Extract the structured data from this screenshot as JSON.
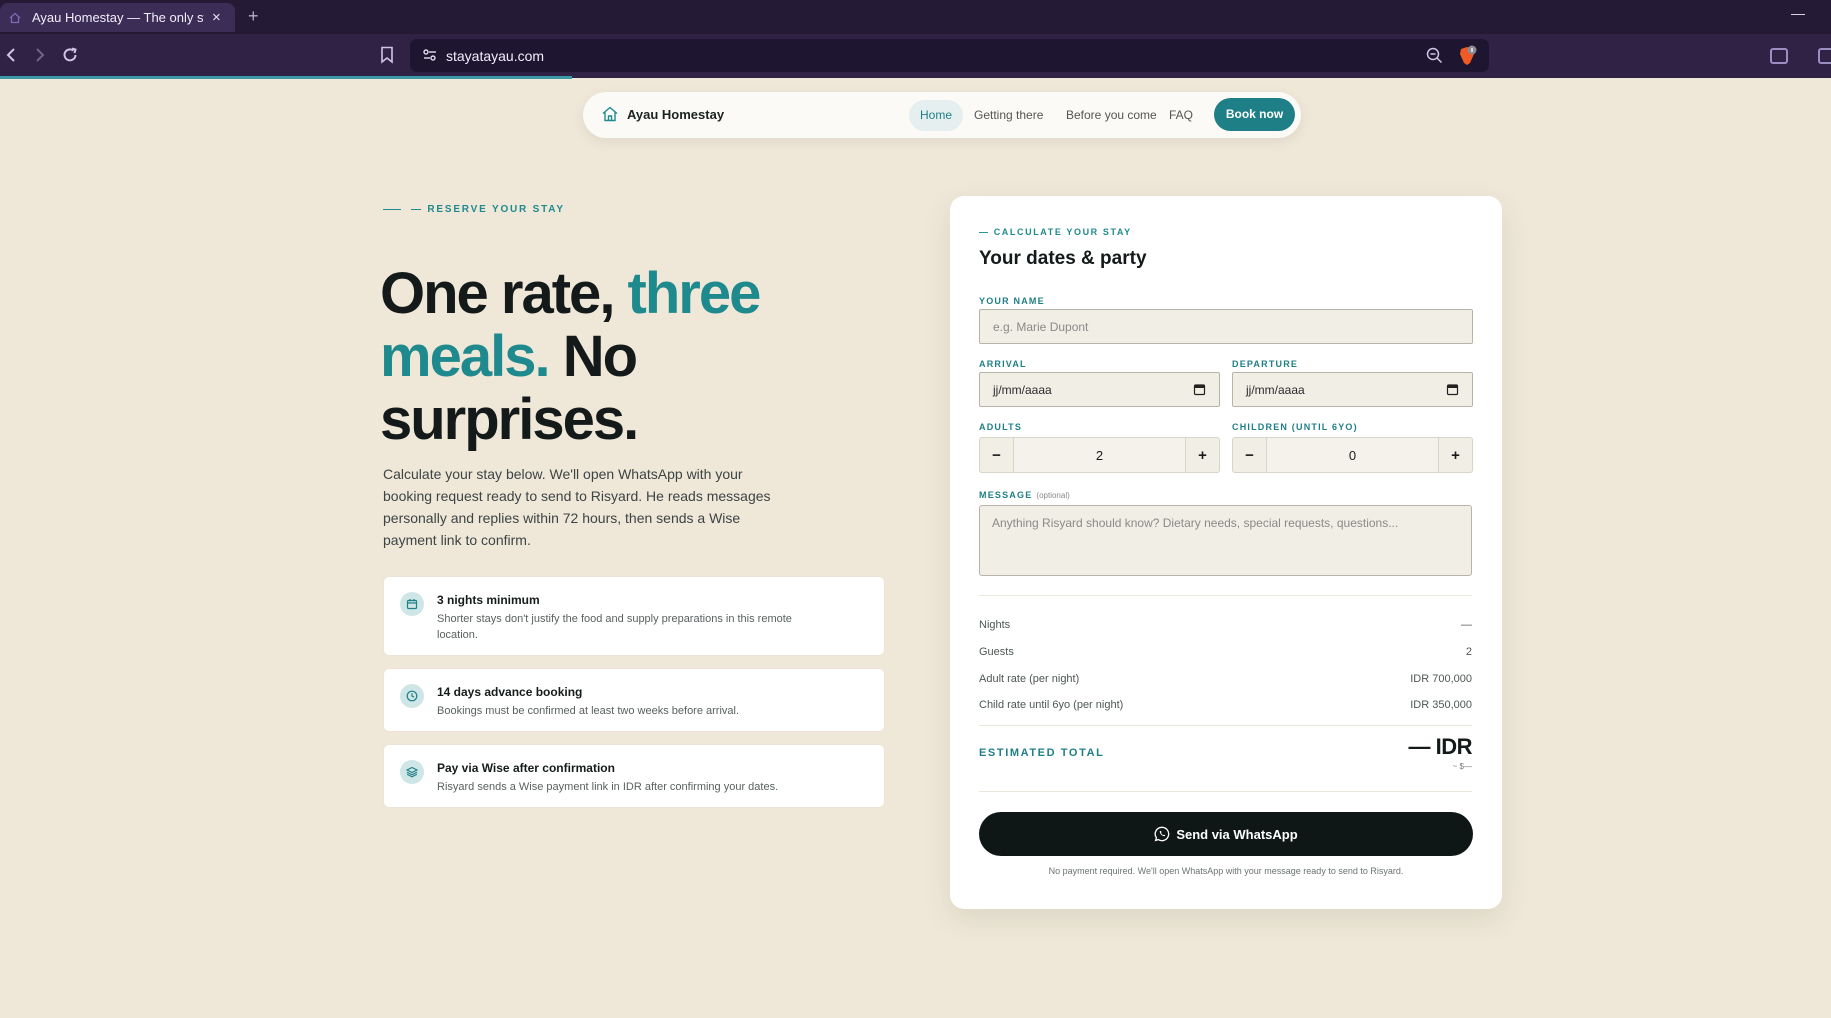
{
  "browser": {
    "tab_title": "Ayau Homestay — The only stay",
    "tab_close": "×",
    "new_tab": "+",
    "minimize": "—",
    "url": "stayatayau.com"
  },
  "nav": {
    "brand": "Ayau Homestay",
    "links": [
      "Home",
      "Getting there",
      "Before you come",
      "FAQ"
    ],
    "cta": "Book now"
  },
  "hero": {
    "eyebrow": "— RESERVE YOUR STAY",
    "title_part1": "One rate, ",
    "title_accent": "three meals.",
    "title_part2": " No surprises.",
    "description": "Calculate your stay below. We'll open WhatsApp with your booking request ready to send to Risyard. He reads messages personally and replies within 72 hours, then sends a Wise payment link to confirm."
  },
  "rules": [
    {
      "icon": "calendar-icon",
      "title": "3 nights minimum",
      "description": "Shorter stays don't justify the food and supply preparations in this remote location."
    },
    {
      "icon": "clock-icon",
      "title": "14 days advance booking",
      "description": "Bookings must be confirmed at least two weeks before arrival."
    },
    {
      "icon": "layers-icon",
      "title": "Pay via Wise after confirmation",
      "description": "Risyard sends a Wise payment link in IDR after confirming your dates."
    }
  ],
  "form": {
    "eyebrow": "— CALCULATE YOUR STAY",
    "title": "Your dates & party",
    "name_label": "YOUR NAME",
    "name_placeholder": "e.g. Marie Dupont",
    "arrival_label": "ARRIVAL",
    "arrival_value": "jj/mm/aaaa",
    "departure_label": "DEPARTURE",
    "departure_value": "jj/mm/aaaa",
    "adults_label": "ADULTS",
    "adults_value": "2",
    "children_label": "CHILDREN (UNTIL 6YO)",
    "children_value": "0",
    "minus": "−",
    "plus": "+",
    "message_label": "MESSAGE",
    "message_optional": "(optional)",
    "message_placeholder": "Anything Risyard should know? Dietary needs, special requests, questions..."
  },
  "summary": {
    "rows": [
      {
        "label": "Nights",
        "value": "—"
      },
      {
        "label": "Guests",
        "value": "2"
      },
      {
        "label": "Adult rate (per night)",
        "value": "IDR 700,000"
      },
      {
        "label": "Child rate until 6yo (per night)",
        "value": "IDR 350,000"
      }
    ],
    "total_label": "ESTIMATED TOTAL",
    "total_value": "— IDR",
    "total_sub": "~ $—",
    "send_button": "Send via WhatsApp",
    "note": "No payment required. We'll open WhatsApp with your message ready to send to Risyard."
  },
  "colors": {
    "accent": "#1f8a8e",
    "background": "#efe8d9",
    "dark_button": "#0f1716"
  }
}
